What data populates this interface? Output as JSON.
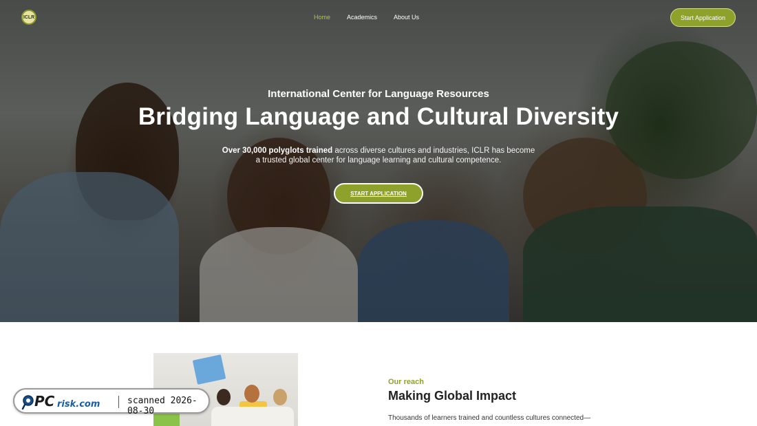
{
  "nav": {
    "logo_text": "ICLR",
    "links": [
      {
        "label": "Home",
        "active": true
      },
      {
        "label": "Academics",
        "active": false
      },
      {
        "label": "About Us",
        "active": false
      }
    ],
    "cta_label": "Start Application"
  },
  "hero": {
    "kicker": "International Center for Language Resources",
    "title": "Bridging Language and Cultural Diversity",
    "desc_strong": "Over 30,000 polyglots trained",
    "desc_rest": " across diverse cultures and industries, ICLR has become a trusted global center for language learning and cultural competence.",
    "cta_label": "START APPLICATION"
  },
  "reach": {
    "kicker": "Our reach",
    "title": "Making Global Impact",
    "text": "Thousands of learners trained and countless cultures connected—our"
  },
  "watermark": {
    "brand_pc": "PC",
    "brand_rest": "risk.com",
    "scan_text": "scanned 2026-08-30"
  },
  "colors": {
    "accent": "#8ea12b",
    "active_link": "#b6c24a",
    "heading": "#222222"
  }
}
